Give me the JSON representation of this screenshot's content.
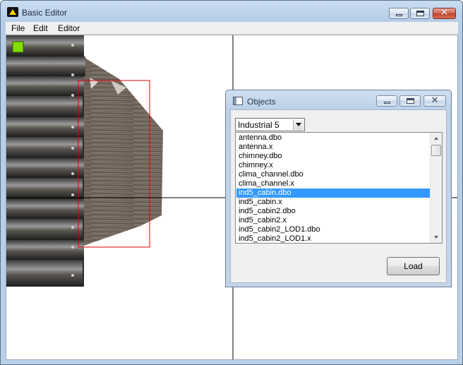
{
  "app": {
    "title": "Basic Editor",
    "icon": "app-logo-icon",
    "controls": {
      "minimize": "minimize-icon",
      "maximize": "maximize-icon",
      "close": "close-icon",
      "close_glyph": "✕"
    }
  },
  "menu": {
    "items": [
      "File",
      "Edit",
      "Editor"
    ]
  },
  "viewport": {
    "indicator_color": "#7fe000",
    "selection_color": "#e00000",
    "axis_color": "#000000"
  },
  "objects_dialog": {
    "title": "Objects",
    "category": {
      "selected": "Industrial 5"
    },
    "files": [
      "antenna.dbo",
      "antenna.x",
      "chimney.dbo",
      "chimney.x",
      "clima_channel.dbo",
      "clima_channel.x",
      "ind5_cabin.dbo",
      "ind5_cabin.x",
      "ind5_cabin2.dbo",
      "ind5_cabin2.x",
      "ind5_cabin2_LOD1.dbo",
      "ind5_cabin2_LOD1.x"
    ],
    "selected_index": 6,
    "load_label": "Load",
    "close_glyph": "✕"
  }
}
